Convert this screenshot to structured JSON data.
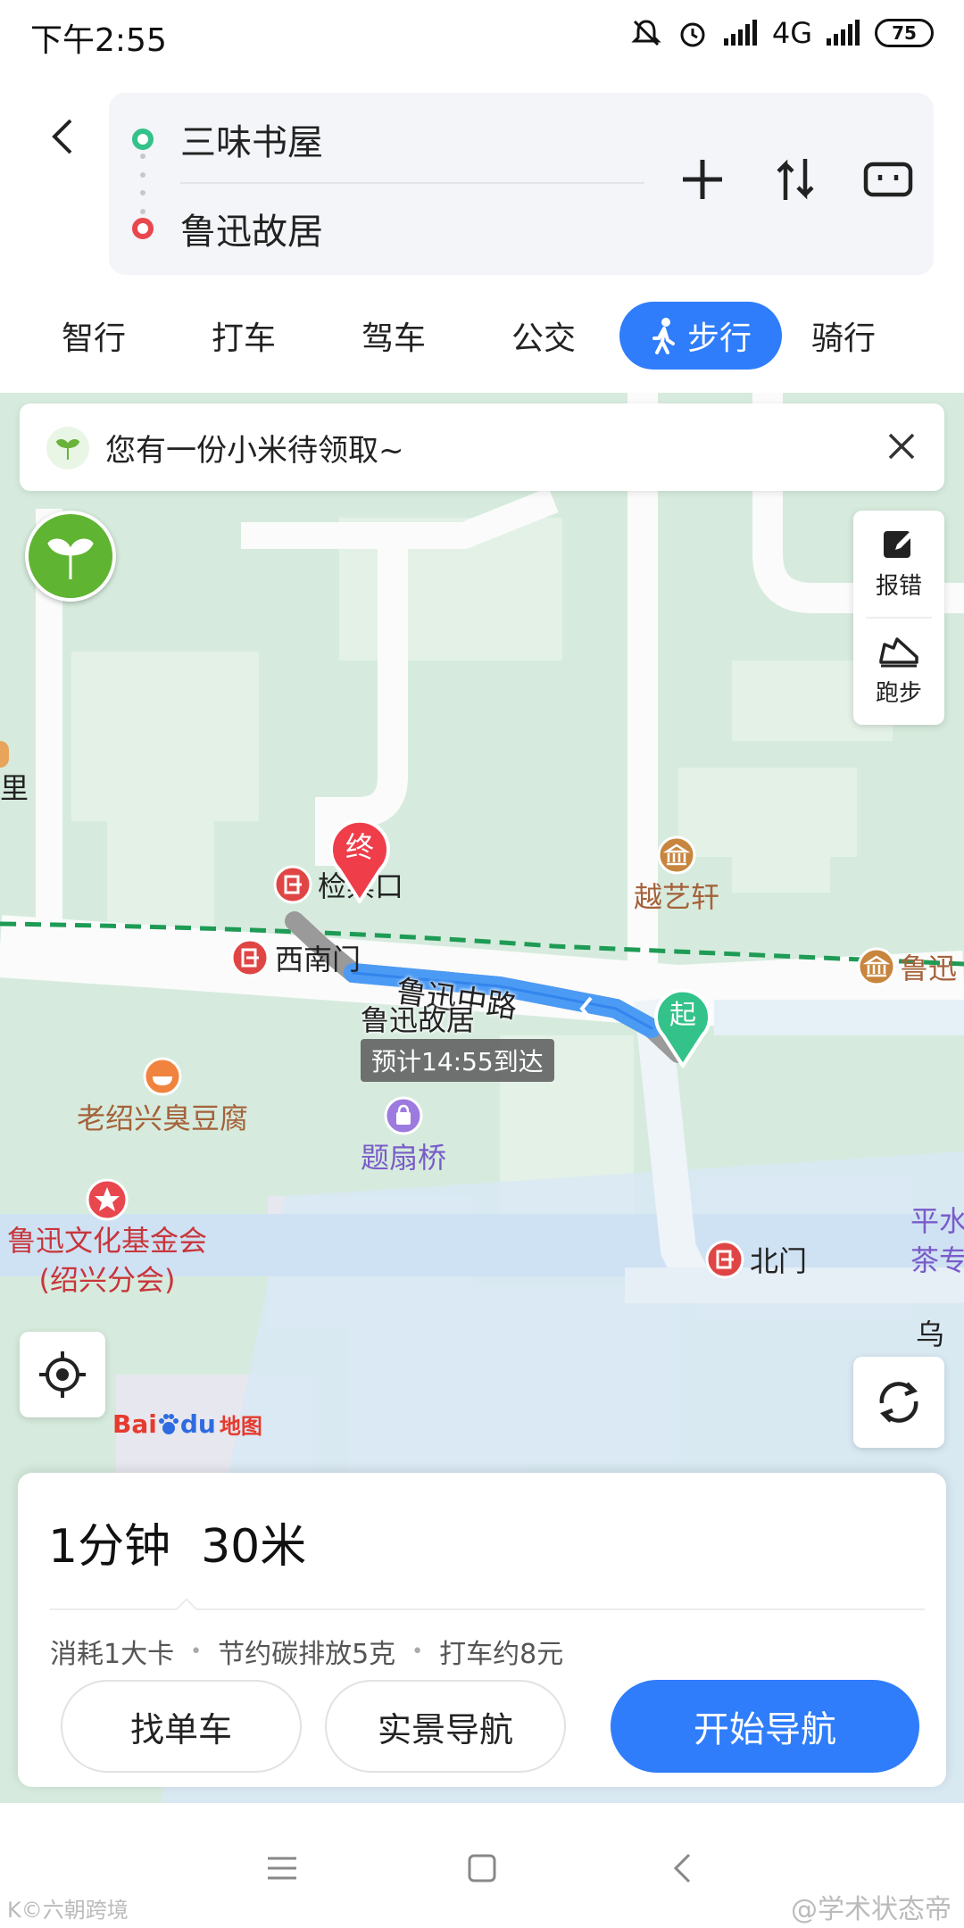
{
  "status_bar": {
    "time": "下午2:55",
    "network": "4G",
    "battery": "75"
  },
  "route": {
    "start": "三味书屋",
    "end": "鲁迅故居",
    "icons": {
      "back": "back-arrow-icon",
      "add": "plus-icon",
      "swap": "swap-icon",
      "more": "card-icon"
    }
  },
  "modes": {
    "smart": "智行",
    "taxi": "打车",
    "drive": "驾车",
    "bus": "公交",
    "walk": "步行",
    "bike": "骑行",
    "active": "步行"
  },
  "promo": {
    "text": "您有一份小米待领取~"
  },
  "side_tools": {
    "report": "报错",
    "run": "跑步"
  },
  "map": {
    "pins": {
      "end": "终",
      "start": "起"
    },
    "pois": {
      "jianhukou": "检票口",
      "xinanmen": "西南门",
      "yueyixuan": "越艺轩",
      "luxun_right": "鲁迅",
      "tofu": "老绍兴臭豆腐",
      "tishanqiao": "题扇桥",
      "foundation_1": "鲁迅文化基金会",
      "foundation_2": "(绍兴分会)",
      "beimen": "北门",
      "pingshui_1": "平水",
      "pingshui_2": "茶专",
      "wu": "乌",
      "li": "里"
    },
    "road_name": "鲁迅中路",
    "dest_label": "鲁迅故居",
    "eta": "预计14:55到达",
    "baidu": {
      "part1": "Bai",
      "part2": "du",
      "part3": "地图"
    }
  },
  "summary": {
    "time": "1分钟",
    "distance": "30米",
    "calories": "消耗1大卡",
    "carbon": "节约碳排放5克",
    "taxi": "打车约8元"
  },
  "buttons": {
    "bike": "找单车",
    "ar_nav": "实景导航",
    "start_nav": "开始导航"
  },
  "watermarks": {
    "left": "K©六朝跨境",
    "right": "@学术状态帝"
  },
  "colors": {
    "accent": "#2f7dfa",
    "start_green": "#33c28a",
    "end_red": "#e9474e",
    "map_green": "#d8ecdf"
  }
}
